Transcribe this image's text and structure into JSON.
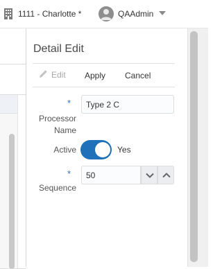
{
  "header": {
    "location": "1111 - Charlotte *",
    "user": "QAAdmin"
  },
  "detail": {
    "title": "Detail Edit",
    "toolbar": {
      "edit_label": "Edit",
      "apply_label": "Apply",
      "cancel_label": "Cancel"
    },
    "fields": {
      "processor_name": {
        "required_mark": "*",
        "label_line1": "Processor",
        "label_line2": "Name",
        "value": "Type 2 C"
      },
      "active": {
        "label": "Active",
        "value_text": "Yes",
        "on": true
      },
      "sequence": {
        "required_mark": "*",
        "label": "Sequence",
        "value": "50"
      }
    }
  },
  "colors": {
    "accent": "#1f71ba",
    "required": "#3b73b9",
    "disabled_text": "#a8a8a8"
  },
  "icons": [
    "building-icon",
    "avatar-icon",
    "caret-down-icon",
    "pencil-icon",
    "chevron-down-icon",
    "chevron-up-icon"
  ]
}
